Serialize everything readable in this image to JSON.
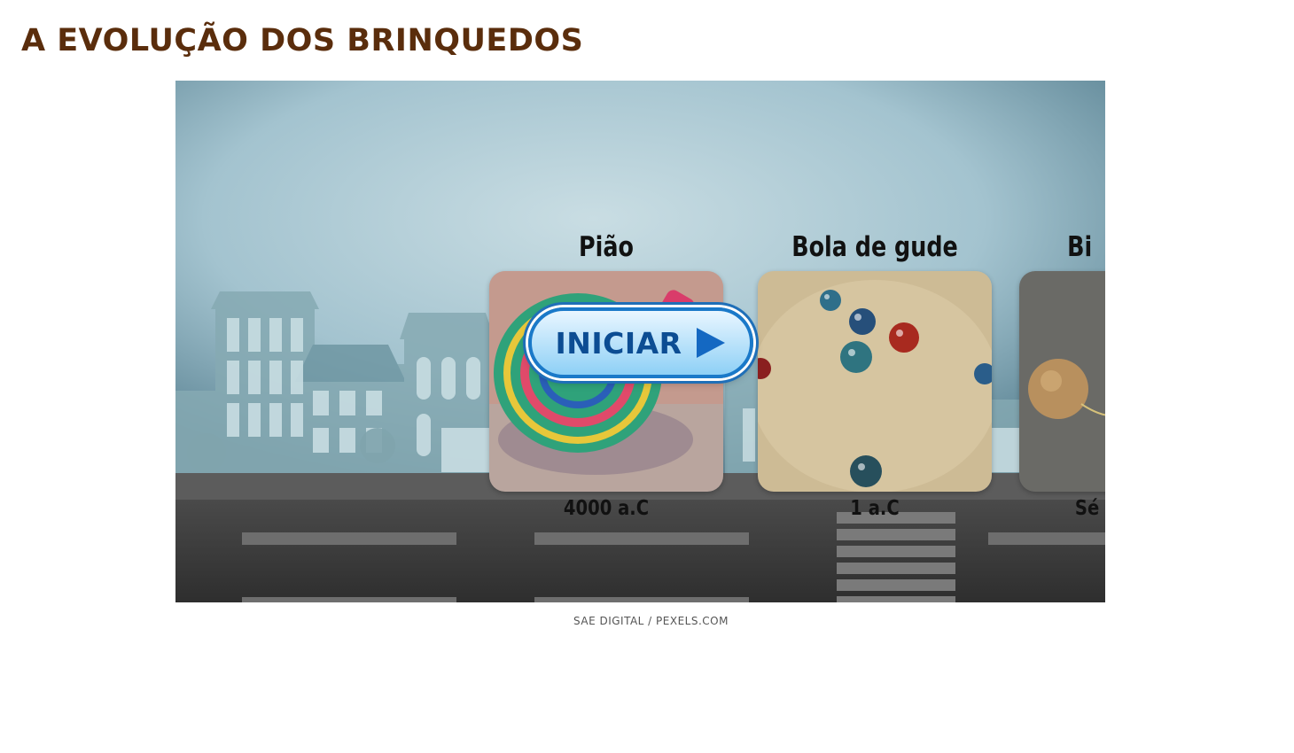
{
  "page": {
    "title": "A EVOLUÇÃO DOS BRINQUEDOS"
  },
  "timeline": {
    "cards": [
      {
        "title": "Pião",
        "date": "4000 a.C",
        "image": "spinning-top-photo"
      },
      {
        "title": "Bola de gude",
        "date": "1 a.C",
        "image": "marbles-photo"
      },
      {
        "title": "Bi",
        "date": "Sé",
        "image": "cup-and-ball-photo"
      }
    ],
    "start_button": {
      "label": "INICIAR",
      "icon": "play-icon"
    }
  },
  "credit": "SAE DIGITAL / PEXELS.COM",
  "colors": {
    "title": "#5a2d0c",
    "button_text": "#0c4d93",
    "button_border": "#1a79c9"
  }
}
